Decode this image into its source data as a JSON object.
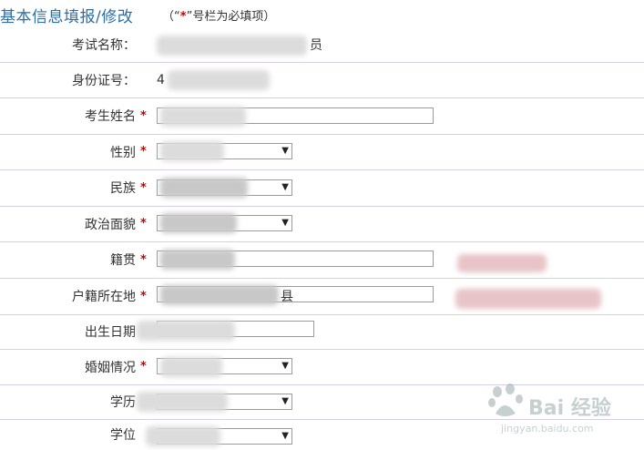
{
  "header": {
    "title": "基本信息填报/修改",
    "note_open": "（",
    "note_quote_open": "“",
    "note_star": "*",
    "note_quote_close": "”",
    "note_text": "号栏为必填项）"
  },
  "rows": [
    {
      "label": "考试名称：",
      "value_suffix": "员"
    },
    {
      "label": "身份证号：",
      "value_prefix": "4"
    },
    {
      "label": "考生姓名",
      "required": "*"
    },
    {
      "label": "性别",
      "required": "*"
    },
    {
      "label": "民族",
      "required": "*"
    },
    {
      "label": "政治面貌",
      "required": "*"
    },
    {
      "label": "籍贯",
      "required": "*"
    },
    {
      "label": "户籍所在地",
      "required": "*",
      "value_suffix": "县"
    },
    {
      "label": "出生日期"
    },
    {
      "label": "婚姻情况",
      "required": "*"
    },
    {
      "label": "学历"
    },
    {
      "label": "学位"
    }
  ],
  "icons": {
    "dropdown": "▼"
  },
  "watermark": {
    "brand": "Bai 经验",
    "url": "jingyan.baidu.com"
  }
}
